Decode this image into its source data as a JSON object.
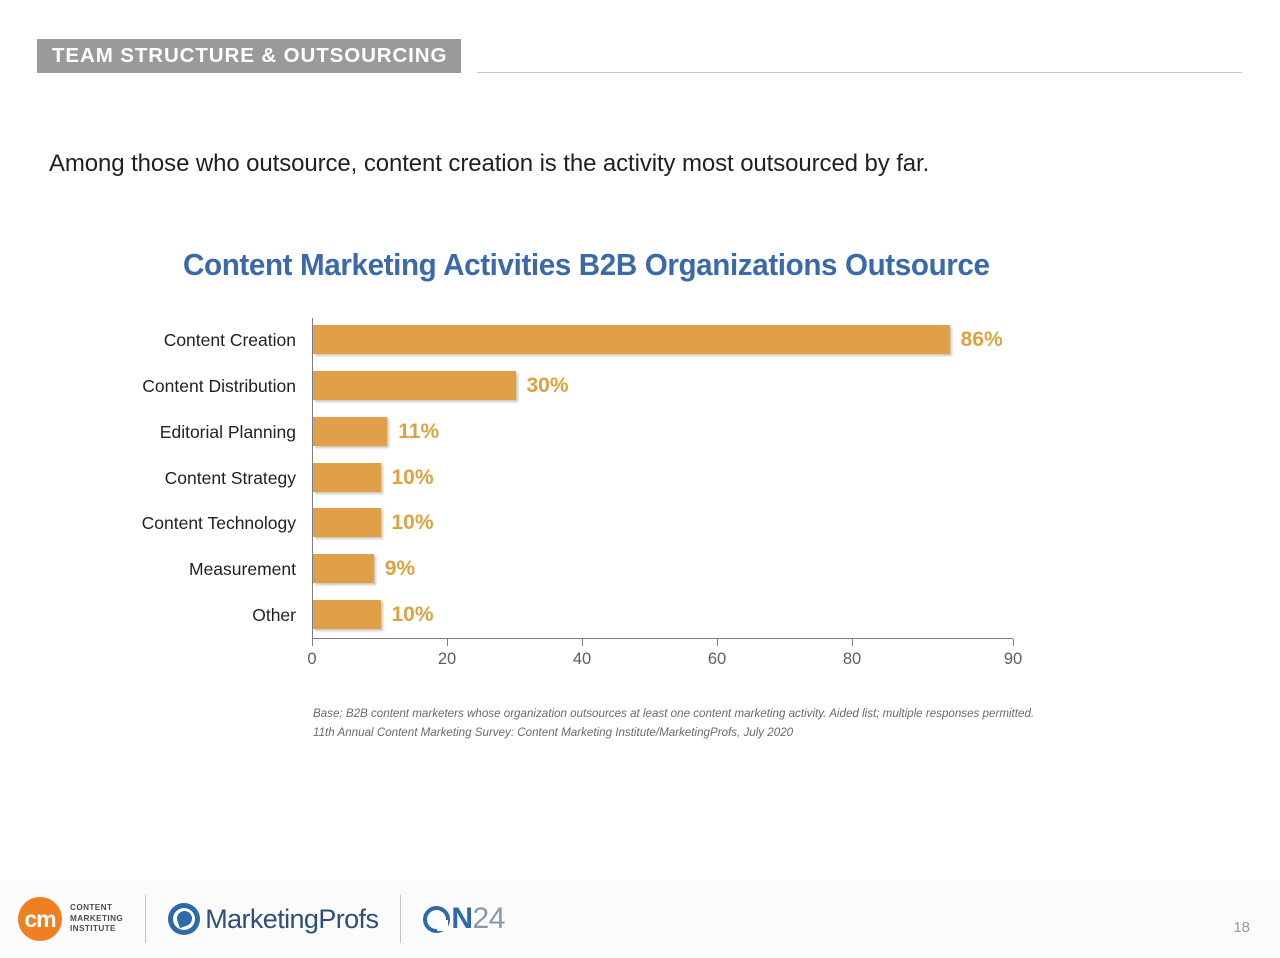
{
  "header": {
    "section_tag": "TEAM STRUCTURE & OUTSOURCING"
  },
  "lead": {
    "text": "Among those who outsource, content creation is the activity most outsourced by far."
  },
  "footnote": {
    "line1": "Base: B2B content marketers whose organization outsources at least one content marketing activity. Aided list; multiple responses permitted.",
    "line2": "11th Annual Content Marketing Survey: Content Marketing Institute/MarketingProfs, July 2020"
  },
  "footer": {
    "cmi": {
      "mark": "cm",
      "line1": "CONTENT",
      "line2": "MARKETING",
      "line3": "INSTITUTE"
    },
    "marketingprofs": {
      "word": "MarketingProfs"
    },
    "on24": {
      "n": "N",
      "num": "24"
    },
    "page_number": "18"
  },
  "colors": {
    "bar": "#e0a04a",
    "value_label": "#dba33f",
    "chart_title": "#3b6aa8",
    "section_tag_bg": "#9a9a9a",
    "axis": "#7d7d7d"
  },
  "chart_data": {
    "type": "bar",
    "orientation": "horizontal",
    "title": "Content Marketing Activities B2B Organizations Outsource",
    "xlabel": "",
    "ylabel": "",
    "categories": [
      "Content Creation",
      "Content Distribution",
      "Editorial Planning",
      "Content Strategy",
      "Content Technology",
      "Measurement",
      "Other"
    ],
    "values": [
      86,
      30,
      11,
      10,
      10,
      9,
      10
    ],
    "value_labels": [
      "86%",
      "30%",
      "11%",
      "10%",
      "10%",
      "9%",
      "10%"
    ],
    "xticks": [
      0,
      20,
      40,
      60,
      80,
      90
    ],
    "xtick_labels": [
      "0",
      "20",
      "40",
      "60",
      "80",
      "90"
    ],
    "xlim": [
      0,
      90
    ],
    "grid": false,
    "legend": false
  }
}
